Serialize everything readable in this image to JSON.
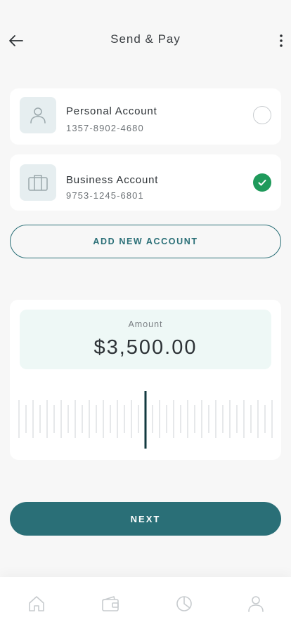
{
  "header": {
    "title": "Send & Pay",
    "back_icon": "arrow-left-icon",
    "more_icon": "more-vertical-icon"
  },
  "accounts": [
    {
      "name": "Personal Account",
      "number": "1357-8902-4680",
      "icon": "user-icon",
      "selected": false
    },
    {
      "name": "Business Account",
      "number": "9753-1245-6801",
      "icon": "briefcase-icon",
      "selected": true
    }
  ],
  "add_account_label": "ADD NEW ACCOUNT",
  "amount": {
    "label": "Amount",
    "value": "$3,500.00"
  },
  "next_label": "NEXT",
  "tabbar": {
    "items": [
      "home-icon",
      "wallet-icon",
      "chart-pie-icon",
      "profile-icon"
    ]
  },
  "colors": {
    "accent": "#2a6f77",
    "selected": "#1f9a5b",
    "amount_bg": "#eef8f6",
    "background": "#f7f7f7"
  }
}
